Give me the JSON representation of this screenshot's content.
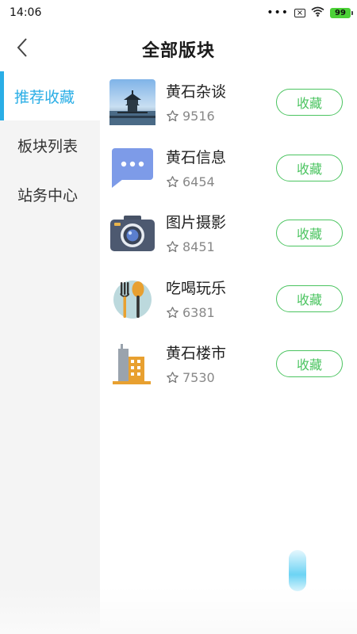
{
  "status_bar": {
    "time": "14:06",
    "battery": "99"
  },
  "header": {
    "title": "全部版块"
  },
  "sidebar": {
    "items": [
      {
        "label": "推荐收藏",
        "active": true
      },
      {
        "label": "板块列表",
        "active": false
      },
      {
        "label": "站务中心",
        "active": false
      }
    ]
  },
  "boards": [
    {
      "name": "黄石杂谈",
      "count": "9516",
      "button": "收藏",
      "icon": "pavilion-photo-icon"
    },
    {
      "name": "黄石信息",
      "count": "6454",
      "button": "收藏",
      "icon": "chat-bubble-icon"
    },
    {
      "name": "图片摄影",
      "count": "8451",
      "button": "收藏",
      "icon": "camera-icon"
    },
    {
      "name": "吃喝玩乐",
      "count": "6381",
      "button": "收藏",
      "icon": "fork-spoon-icon"
    },
    {
      "name": "黄石楼市",
      "count": "7530",
      "button": "收藏",
      "icon": "buildings-icon"
    }
  ],
  "colors": {
    "accent": "#2aaee6",
    "button_green": "#4bc460"
  }
}
